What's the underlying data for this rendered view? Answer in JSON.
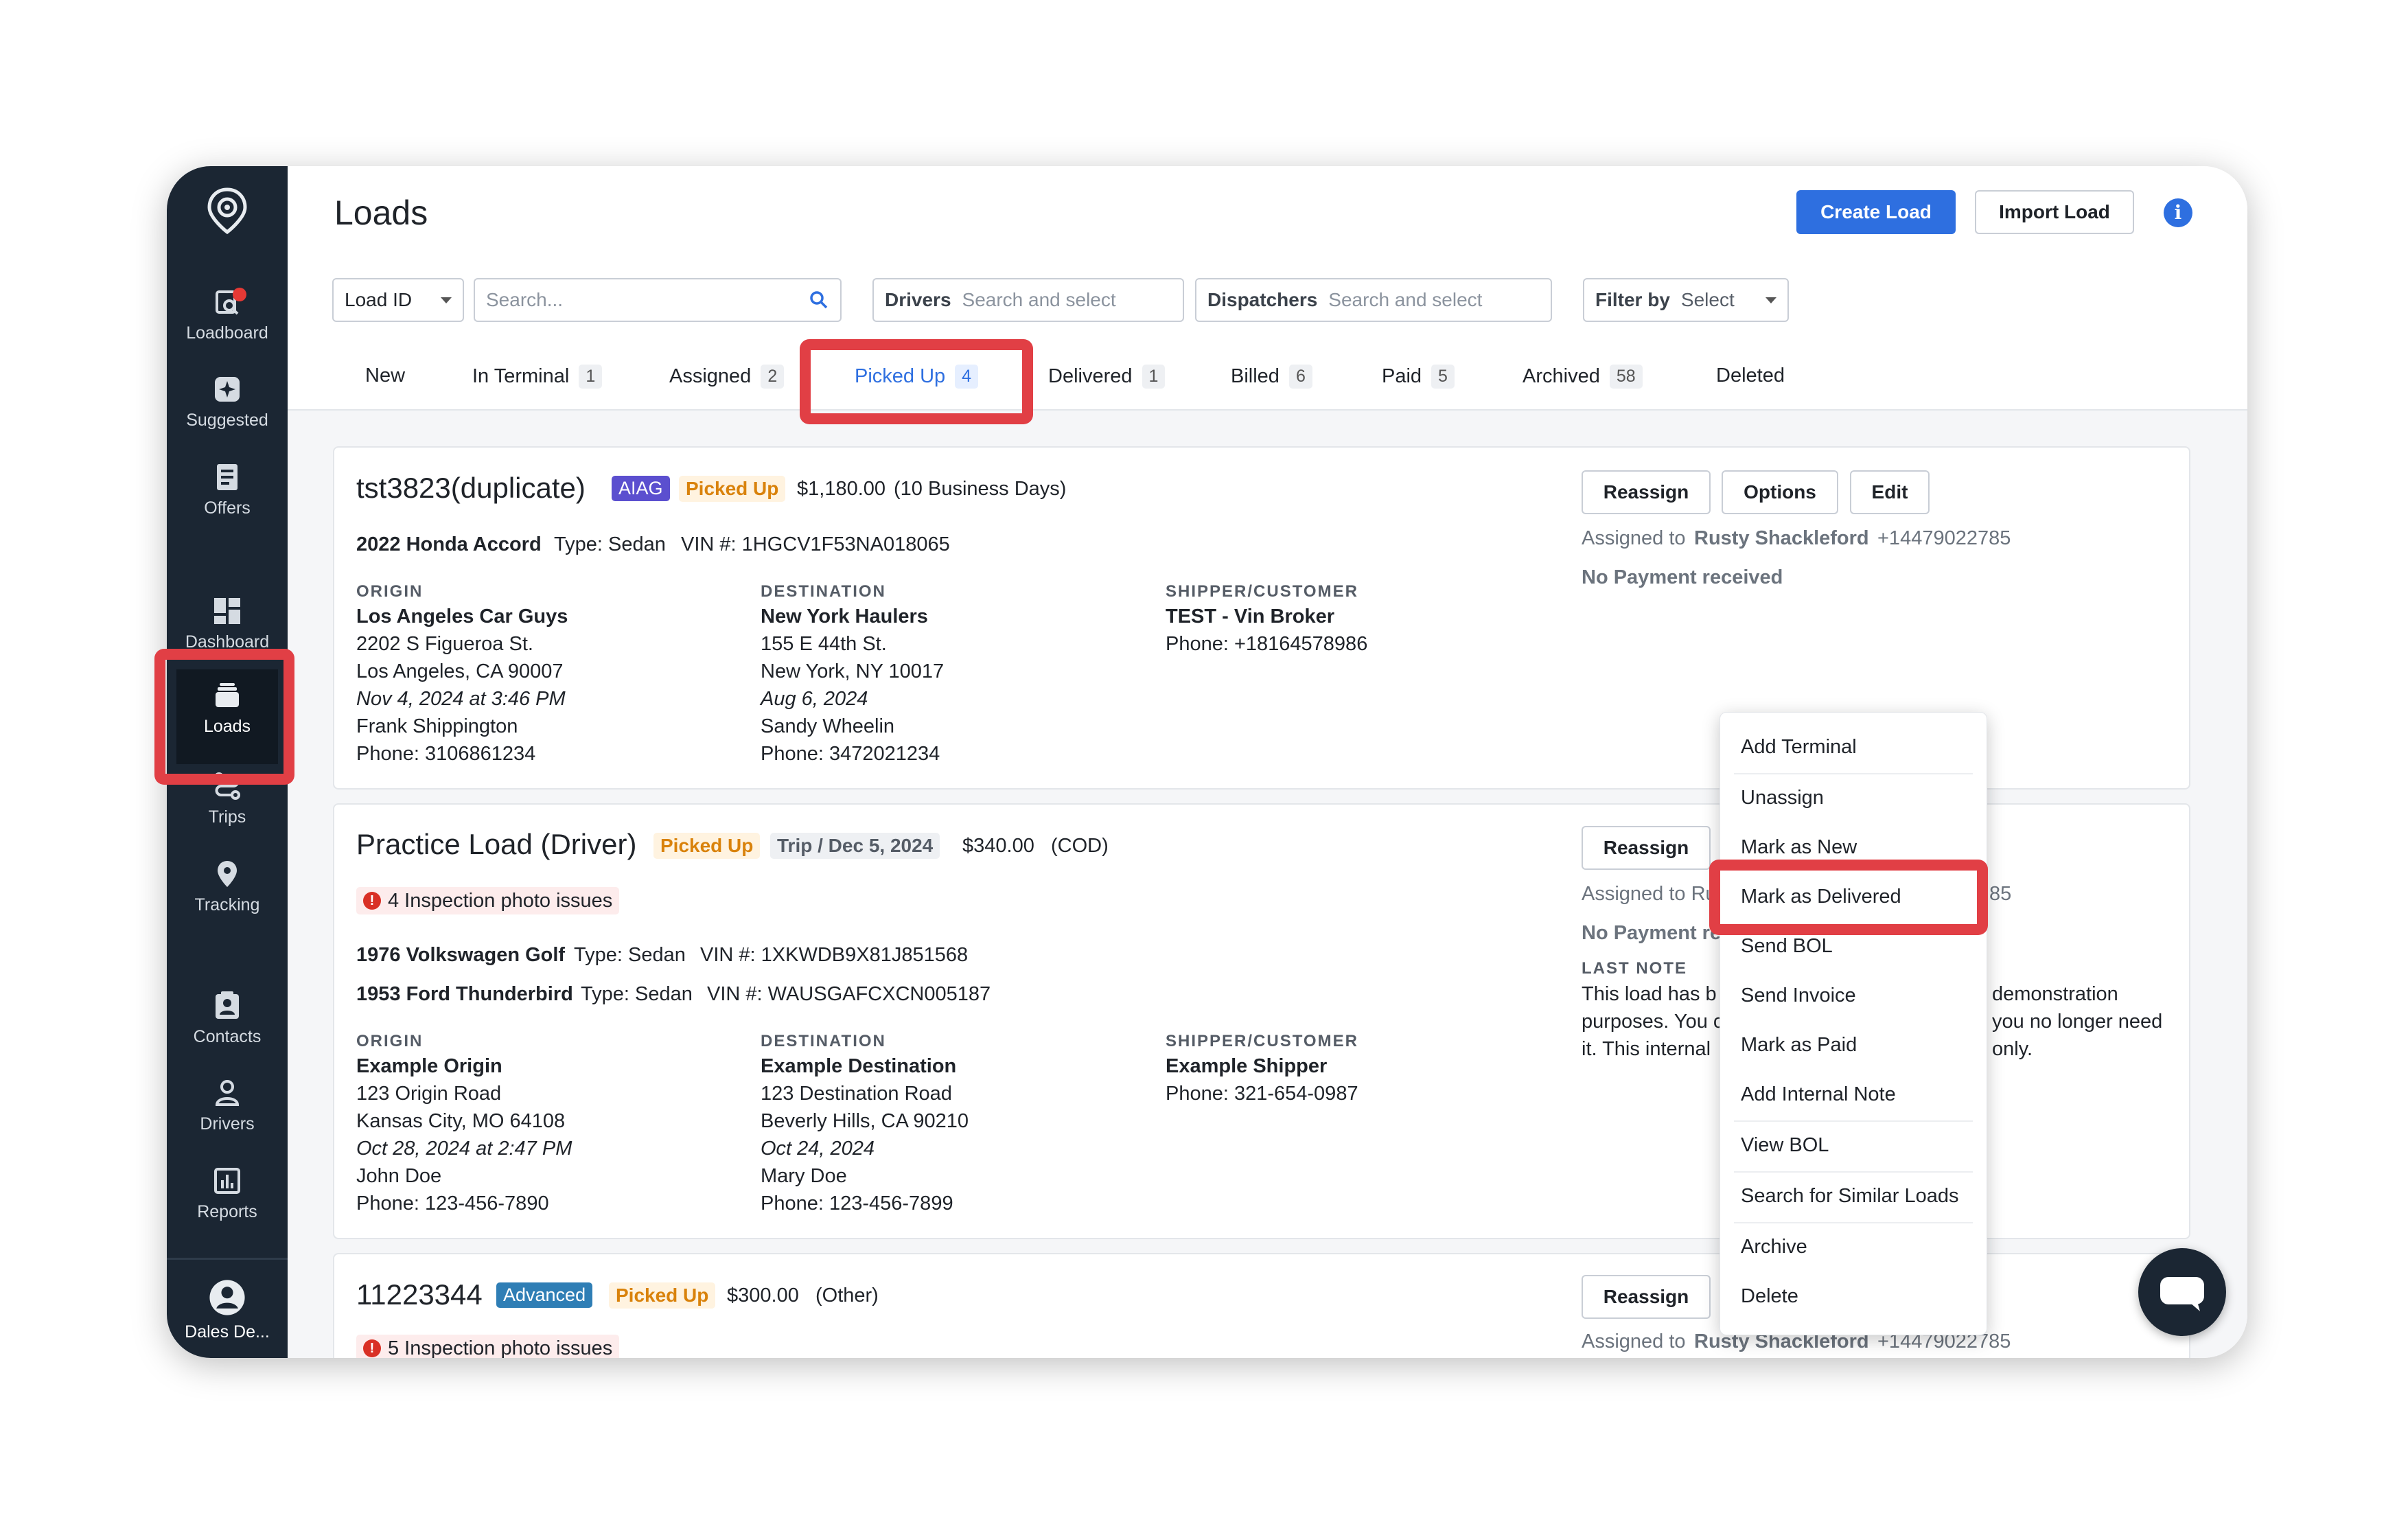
{
  "app": {
    "page_title": "Loads",
    "accent_color": "#2e6fe0",
    "highlight_color": "#e13f45"
  },
  "header": {
    "create_load": "Create Load",
    "import_load": "Import Load",
    "info_glyph": "i"
  },
  "sidebar": {
    "items": [
      {
        "label": "Loadboard",
        "icon": "loadboard-icon"
      },
      {
        "label": "Suggested",
        "icon": "suggested-icon"
      },
      {
        "label": "Offers",
        "icon": "offers-icon"
      },
      {
        "label": "Dashboard",
        "icon": "dashboard-icon"
      },
      {
        "label": "Loads",
        "icon": "loads-icon"
      },
      {
        "label": "Trips",
        "icon": "trips-icon"
      },
      {
        "label": "Tracking",
        "icon": "tracking-icon"
      },
      {
        "label": "Contacts",
        "icon": "contacts-icon"
      },
      {
        "label": "Drivers",
        "icon": "drivers-icon"
      },
      {
        "label": "Reports",
        "icon": "reports-icon"
      }
    ],
    "user": "Dales De..."
  },
  "filters": {
    "id_select": "Load ID",
    "search_placeholder": "Search...",
    "drivers_label": "Drivers",
    "drivers_placeholder": "Search and select",
    "dispatchers_label": "Dispatchers",
    "dispatchers_placeholder": "Search and select",
    "filter_label": "Filter by",
    "filter_value": "Select"
  },
  "tabs": [
    {
      "label": "New",
      "count": ""
    },
    {
      "label": "In Terminal",
      "count": "1"
    },
    {
      "label": "Assigned",
      "count": "2"
    },
    {
      "label": "Picked Up",
      "count": "4",
      "active": true
    },
    {
      "label": "Delivered",
      "count": "1"
    },
    {
      "label": "Billed",
      "count": "6"
    },
    {
      "label": "Paid",
      "count": "5"
    },
    {
      "label": "Archived",
      "count": "58"
    },
    {
      "label": "Deleted",
      "count": ""
    }
  ],
  "labels": {
    "origin": "ORIGIN",
    "destination": "DESTINATION",
    "shipper": "SHIPPER/CUSTOMER",
    "last_note": "LAST NOTE",
    "reassign": "Reassign",
    "options": "Options",
    "edit": "Edit",
    "assigned_to": "Assigned to"
  },
  "loads": [
    {
      "title": "tst3823(duplicate)",
      "tag": "AIAG",
      "status": "Picked Up",
      "price": "$1,180.00",
      "terms": "(10 Business Days)",
      "vehicles": [
        {
          "name": "2022 Honda Accord",
          "type": "Type: Sedan",
          "vin": "VIN #: 1HGCV1F53NA018065"
        }
      ],
      "origin": {
        "name": "Los Angeles Car Guys",
        "street": "2202 S Figueroa St.",
        "city": "Los Angeles, CA 90007",
        "date": "Nov 4, 2024 at 3:46 PM",
        "contact": "Frank Shippington",
        "phone": "Phone: 3106861234"
      },
      "destination": {
        "name": "New York Haulers",
        "street": "155 E 44th St.",
        "city": "New York, NY 10017",
        "date": "Aug 6, 2024",
        "contact": "Sandy Wheelin",
        "phone": "Phone: 3472021234"
      },
      "shipper": {
        "name": "TEST - Vin Broker",
        "phone": "Phone: +18164578986"
      },
      "assigned_name": "Rusty Shackleford",
      "assigned_phone": "+14479022785",
      "payment": "No Payment received"
    },
    {
      "title": "Practice Load (Driver)",
      "status": "Picked Up",
      "trip": "Trip / Dec 5, 2024",
      "price": "$340.00",
      "terms": "(COD)",
      "issues": "4 Inspection photo issues",
      "vehicles": [
        {
          "name": "1976 Volkswagen Golf",
          "type": "Type: Sedan",
          "vin": "VIN #: 1XKWDB9X81J851568"
        },
        {
          "name": "1953 Ford Thunderbird",
          "type": "Type: Sedan",
          "vin": "VIN #: WAUSGAFCXCN005187"
        }
      ],
      "origin": {
        "name": "Example Origin",
        "street": "123 Origin Road",
        "city": "Kansas City, MO 64108",
        "date": "Oct 28, 2024 at 2:47 PM",
        "contact": "John Doe",
        "phone": "Phone: 123-456-7890"
      },
      "destination": {
        "name": "Example Destination",
        "street": "123 Destination Road",
        "city": "Beverly Hills, CA 90210",
        "date": "Oct 24, 2024",
        "contact": "Mary Doe",
        "phone": "Phone: 123-456-7899"
      },
      "shipper": {
        "name": "Example Shipper",
        "phone": "Phone: 321-654-0987"
      },
      "assigned_visible": "Assigned to Ru",
      "assigned_tail": "85",
      "payment_visible": "No Payment re",
      "note_left": [
        "This load has b",
        "purposes. You c",
        "it. This internal"
      ],
      "note_right": [
        "demonstration",
        "you no longer need",
        "only."
      ]
    },
    {
      "title": "11223344",
      "tag": "Advanced",
      "status": "Picked Up",
      "price": "$300.00",
      "terms": "(Other)",
      "issues": "5 Inspection photo issues",
      "assigned_name": "Rusty Shackleford",
      "assigned_phone": "+14479022785"
    }
  ],
  "context_menu": [
    "Add Terminal",
    "Unassign",
    "Mark as New",
    "Mark as Delivered",
    "Send BOL",
    "Send Invoice",
    "Mark as Paid",
    "Add Internal Note",
    "View BOL",
    "Search for Similar Loads",
    "Archive",
    "Delete"
  ]
}
